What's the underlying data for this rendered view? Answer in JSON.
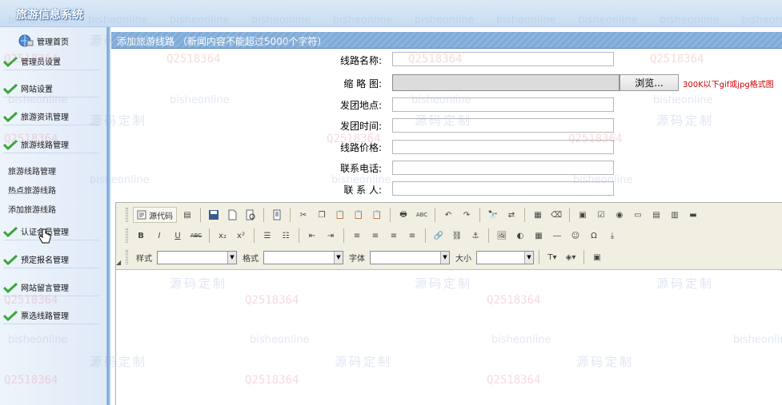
{
  "app": {
    "title": "旅游信息系统"
  },
  "sidebar": {
    "home_label": "管理首页",
    "items": [
      {
        "label": "管理员设置",
        "icon": "check-arrow-icon"
      },
      {
        "label": "网站设置",
        "icon": "check-arrow-icon"
      },
      {
        "label": "旅游资讯管理",
        "icon": "check-arrow-icon"
      },
      {
        "label": "旅游线路管理",
        "icon": "check-arrow-icon"
      },
      {
        "label": "认证会员管理",
        "icon": "check-arrow-icon"
      },
      {
        "label": "预定报名管理",
        "icon": "check-arrow-icon"
      },
      {
        "label": "网站留言管理",
        "icon": "check-arrow-icon"
      },
      {
        "label": "票选线路管理",
        "icon": "check-arrow-icon"
      }
    ],
    "subitems": [
      "旅游线路管理",
      "热点旅游线路",
      "添加旅游线路"
    ]
  },
  "main": {
    "title": "添加旅游线路 （新闻内容不能超过5000个字符）",
    "fields": {
      "route_name": {
        "label": "线路名称:",
        "value": ""
      },
      "thumbnail": {
        "label": "缩 略 图:"
      },
      "start_place": {
        "label": "发团地点:",
        "value": ""
      },
      "start_time": {
        "label": "发团时间:",
        "value": ""
      },
      "price": {
        "label": "线路价格:",
        "value": ""
      },
      "phone": {
        "label": "联系电话:",
        "value": ""
      },
      "contact": {
        "label": "联 系 人:",
        "value": ""
      }
    },
    "browse_label": "浏览...",
    "file_hint": "300K以下gif或jpg格式图"
  },
  "editor": {
    "source_label": "源代码",
    "style_label": "样式",
    "format_label": "格式",
    "font_label": "字体",
    "size_label": "大小",
    "bold": "B",
    "italic": "I",
    "underline": "U",
    "strike": "ABC",
    "subscript": "x₂",
    "superscript": "x²",
    "spellcheck": "ABC",
    "collapse": "◢"
  },
  "watermark": {
    "text_a": "bisheonline",
    "text_b": "源码定制",
    "text_c": "Q2518364"
  },
  "colors": {
    "title_bar": "#7faad7",
    "hint_red": "#d00000",
    "sidebar_bg": "#e6eef8",
    "check_green": "#3aa63a"
  }
}
